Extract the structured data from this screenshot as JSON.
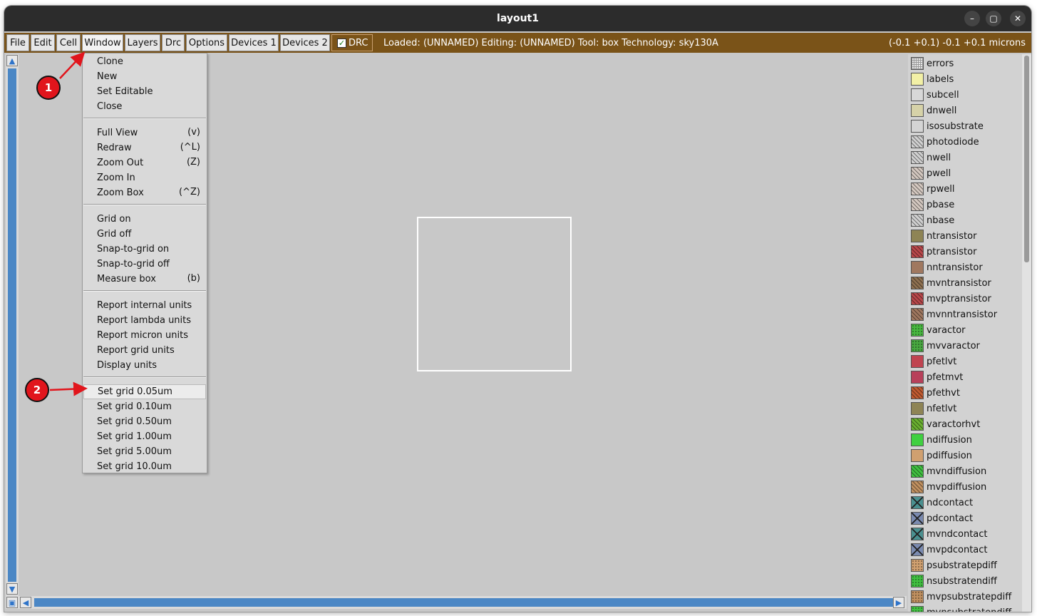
{
  "window": {
    "title": "layout1",
    "controls": [
      "–",
      "▢",
      "✕"
    ]
  },
  "menubar": {
    "items": [
      "File",
      "Edit",
      "Cell",
      "Window",
      "Layers",
      "Drc",
      "Options",
      "Devices 1",
      "Devices 2"
    ],
    "drc_label": "DRC",
    "drc_checked": true,
    "status": "Loaded: (UNNAMED) Editing: (UNNAMED) Tool: box  Technology: sky130A",
    "coords": "(-0.1 +0.1) -0.1 +0.1 microns"
  },
  "window_menu": {
    "groups": [
      [
        {
          "label": "Clone",
          "accel": ""
        },
        {
          "label": "New",
          "accel": ""
        },
        {
          "label": "Set Editable",
          "accel": ""
        },
        {
          "label": "Close",
          "accel": ""
        }
      ],
      [
        {
          "label": "Full View",
          "accel": "(v)"
        },
        {
          "label": "Redraw",
          "accel": "(^L)"
        },
        {
          "label": "Zoom Out",
          "accel": "(Z)"
        },
        {
          "label": "Zoom In",
          "accel": ""
        },
        {
          "label": "Zoom Box",
          "accel": "(^Z)"
        }
      ],
      [
        {
          "label": "Grid on",
          "accel": ""
        },
        {
          "label": "Grid off",
          "accel": ""
        },
        {
          "label": "Snap-to-grid on",
          "accel": ""
        },
        {
          "label": "Snap-to-grid off",
          "accel": ""
        },
        {
          "label": "Measure box",
          "accel": "(b)"
        }
      ],
      [
        {
          "label": "Report internal units",
          "accel": ""
        },
        {
          "label": "Report lambda units",
          "accel": ""
        },
        {
          "label": "Report micron units",
          "accel": ""
        },
        {
          "label": "Report grid units",
          "accel": ""
        },
        {
          "label": "Display units",
          "accel": ""
        }
      ],
      [
        {
          "label": "Set grid 0.05um",
          "accel": "",
          "highlighted": true
        },
        {
          "label": "Set grid 0.10um",
          "accel": ""
        },
        {
          "label": "Set grid 0.50um",
          "accel": ""
        },
        {
          "label": "Set grid 1.00um",
          "accel": ""
        },
        {
          "label": "Set grid 5.00um",
          "accel": ""
        },
        {
          "label": "Set grid 10.0um",
          "accel": ""
        }
      ]
    ]
  },
  "annotations": [
    {
      "label": "1"
    },
    {
      "label": "2"
    }
  ],
  "layers": [
    {
      "name": "errors",
      "color": "#e8e8e8",
      "pattern": "grid"
    },
    {
      "name": "labels",
      "color": "#f2f0a6",
      "pattern": "none"
    },
    {
      "name": "subcell",
      "color": "#d8d8d8",
      "pattern": "none"
    },
    {
      "name": "dnwell",
      "color": "#d6d2a8",
      "pattern": "none"
    },
    {
      "name": "isosubstrate",
      "color": "#d4d4d4",
      "pattern": "none"
    },
    {
      "name": "photodiode",
      "color": "#d0d0d0",
      "pattern": "hatch"
    },
    {
      "name": "nwell",
      "color": "#d0d0d0",
      "pattern": "hatch"
    },
    {
      "name": "pwell",
      "color": "#d4c8c0",
      "pattern": "hatch"
    },
    {
      "name": "rpwell",
      "color": "#d4c8c0",
      "pattern": "hatch"
    },
    {
      "name": "pbase",
      "color": "#d4c8c0",
      "pattern": "hatch"
    },
    {
      "name": "nbase",
      "color": "#d0d0d0",
      "pattern": "hatch"
    },
    {
      "name": "ntransistor",
      "color": "#8e8455",
      "pattern": "none"
    },
    {
      "name": "ptransistor",
      "color": "#b8474a",
      "pattern": "hatch"
    },
    {
      "name": "nntransistor",
      "color": "#a07860",
      "pattern": "none"
    },
    {
      "name": "mvntransistor",
      "color": "#8e7050",
      "pattern": "hatch"
    },
    {
      "name": "mvptransistor",
      "color": "#b8474a",
      "pattern": "hatch"
    },
    {
      "name": "mvnntransistor",
      "color": "#a07860",
      "pattern": "hatch"
    },
    {
      "name": "varactor",
      "color": "#48b840",
      "pattern": "dots"
    },
    {
      "name": "mvvaractor",
      "color": "#48a840",
      "pattern": "dots"
    },
    {
      "name": "pfetlvt",
      "color": "#c04450",
      "pattern": "none"
    },
    {
      "name": "pfetmvt",
      "color": "#b8405a",
      "pattern": "none"
    },
    {
      "name": "pfethvt",
      "color": "#c05a30",
      "pattern": "hatch"
    },
    {
      "name": "nfetlvt",
      "color": "#8e8455",
      "pattern": "none"
    },
    {
      "name": "varactorhvt",
      "color": "#6ab030",
      "pattern": "hatch"
    },
    {
      "name": "ndiffusion",
      "color": "#40d040",
      "pattern": "none"
    },
    {
      "name": "pdiffusion",
      "color": "#d0a070",
      "pattern": "none"
    },
    {
      "name": "mvndiffusion",
      "color": "#40c040",
      "pattern": "hatch"
    },
    {
      "name": "mvpdiffusion",
      "color": "#c09060",
      "pattern": "hatch"
    },
    {
      "name": "ndcontact",
      "color": "#4a9090",
      "pattern": "cross"
    },
    {
      "name": "pdcontact",
      "color": "#7a8ab0",
      "pattern": "cross"
    },
    {
      "name": "mvndcontact",
      "color": "#4a9090",
      "pattern": "cross"
    },
    {
      "name": "mvpdcontact",
      "color": "#7a8ab0",
      "pattern": "cross"
    },
    {
      "name": "psubstratepdiff",
      "color": "#d0a070",
      "pattern": "dots"
    },
    {
      "name": "nsubstratendiff",
      "color": "#40c040",
      "pattern": "dots"
    },
    {
      "name": "mvpsubstratepdiff",
      "color": "#c09060",
      "pattern": "dots"
    },
    {
      "name": "mvnsubstratendiff",
      "color": "#40c040",
      "pattern": "dots"
    }
  ],
  "colors": {
    "menubar_bg": "#7a5318",
    "titlebar_bg": "#2c2c2c",
    "scroll_track": "#4b87c5",
    "annotation_red": "#e1151c",
    "canvas_bg": "#c8c8c8"
  }
}
